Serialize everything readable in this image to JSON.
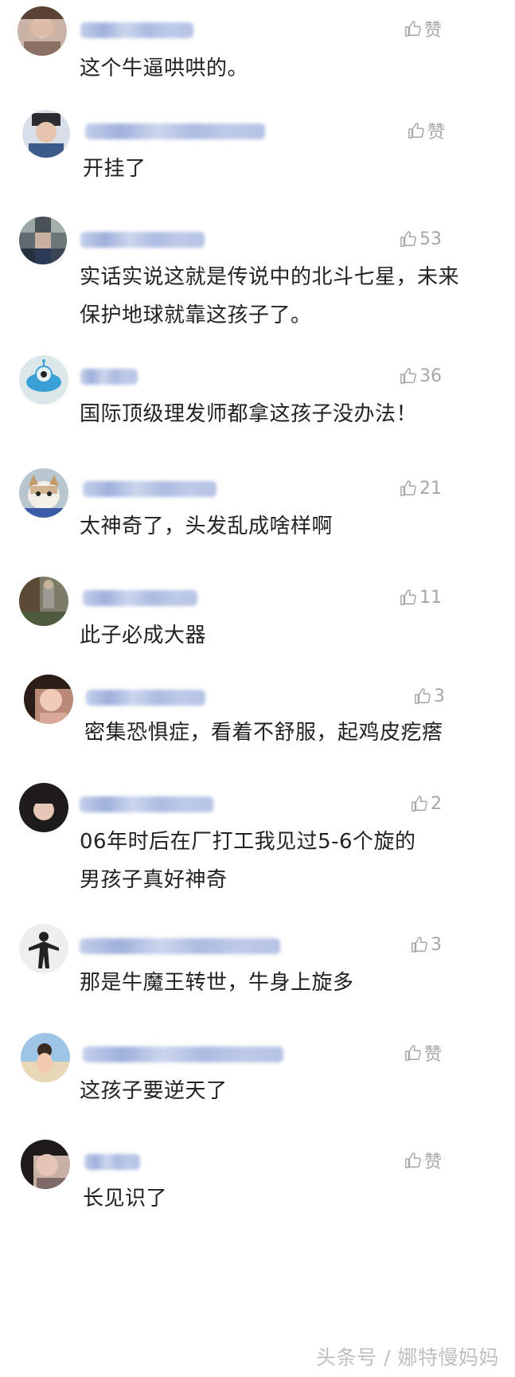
{
  "comments": [
    {
      "avatar": "avatar-woman-blurred",
      "likes": "赞",
      "text": "这个牛逼哄哄的。"
    },
    {
      "avatar": "avatar-boy-blurred",
      "likes": "赞",
      "text": "开挂了"
    },
    {
      "avatar": "avatar-child-pixelated",
      "likes": "53",
      "text": "实话实说这就是传说中的北斗七星，未来保护地球就靠这孩子了。"
    },
    {
      "avatar": "avatar-alien-cartoon",
      "likes": "36",
      "text": "国际顶级理发师都拿这孩子没办法！"
    },
    {
      "avatar": "avatar-cat",
      "likes": "21",
      "text": "太神奇了，头发乱成啥样啊"
    },
    {
      "avatar": "avatar-outdoor-photo",
      "likes": "11",
      "text": "此子必成大器"
    },
    {
      "avatar": "avatar-girl-blurred",
      "likes": "3",
      "text": "密集恐惧症，看着不舒服，起鸡皮疙瘩"
    },
    {
      "avatar": "avatar-girl-dark-hair",
      "likes": "2",
      "text": "06年时后在厂打工我见过5-6个旋的男孩子真好神奇"
    },
    {
      "avatar": "avatar-silhouette",
      "likes": "3",
      "text": "那是牛魔王转世，牛身上旋多"
    },
    {
      "avatar": "avatar-beach-child",
      "likes": "赞",
      "text": "这孩子要逆天了"
    },
    {
      "avatar": "avatar-woman-blurred-2",
      "likes": "赞",
      "text": "长见识了"
    }
  ],
  "watermark": "头条号 / 娜特慢妈妈",
  "colors": {
    "text": "#222222",
    "like": "#a6a6a6",
    "name_blur": "#9eb0dc",
    "watermark": "#bfbfbf"
  }
}
